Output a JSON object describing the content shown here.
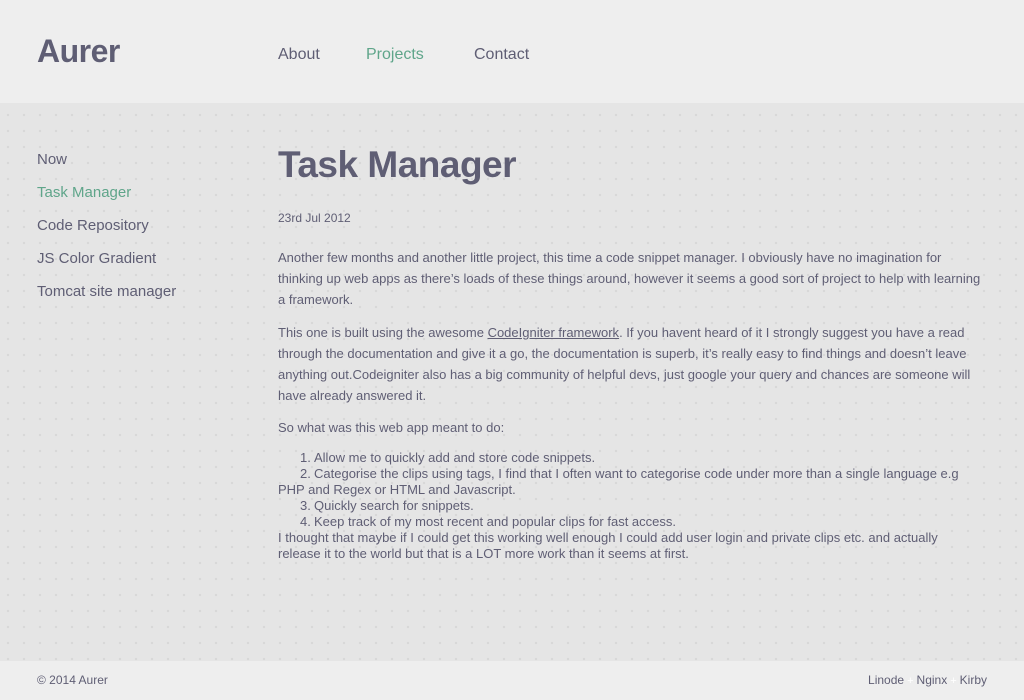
{
  "site": {
    "logo": "Aurer"
  },
  "nav": [
    {
      "label": "About",
      "active": false
    },
    {
      "label": "Projects",
      "active": true
    },
    {
      "label": "Contact",
      "active": false
    }
  ],
  "sidebar": [
    {
      "label": "Now",
      "active": false
    },
    {
      "label": "Task Manager",
      "active": true
    },
    {
      "label": "Code Repository",
      "active": false
    },
    {
      "label": "JS Color Gradient",
      "active": false
    },
    {
      "label": "Tomcat site manager",
      "active": false
    }
  ],
  "article": {
    "title": "Task Manager",
    "date": "23rd Jul 2012",
    "p1": "Another few months and another little project, this time a code snippet manager. I obviously have no imagination for thinking up web apps as there’s loads of these things around, however it seems a good sort of project to help with learning a framework.",
    "p2_before": "This one is built using the awesome ",
    "p2_link": "CodeIgniter framework",
    "p2_after": ". If you havent heard of it I strongly suggest you have a read through the documentation and give it a go, the documentation is superb, it’s really easy to find things and doesn’t leave anything out.Codeigniter also has a big community of helpful devs, just google your query and chances are someone will have already answered it.",
    "p3": "So what was this web app meant to do:",
    "list": [
      {
        "num": "1.",
        "text": "Allow me to quickly add and store code snippets."
      },
      {
        "num": "2.",
        "text": "Categorise the clips using tags, I find that I often want to categorise code under more than a single language e.g PHP and Regex or HTML and Javascript."
      },
      {
        "num": "3.",
        "text": "Quickly search for snippets."
      },
      {
        "num": "4.",
        "text": "Keep track of my most recent and popular clips for fast access."
      }
    ],
    "closing": "I thought that maybe if I could get this working well enough I could add user login and private clips etc. and actually release it to the world but that is a LOT more work than it seems at first."
  },
  "footer": {
    "copyright": "© 2014 Aurer",
    "credits": [
      "Linode",
      "Nginx",
      "Kirby"
    ],
    "separator": "+"
  },
  "colors": {
    "text": "#5f5e74",
    "accent": "#5fa58a",
    "header_bg": "#eeeeee",
    "main_bg": "#e5e5e5"
  }
}
